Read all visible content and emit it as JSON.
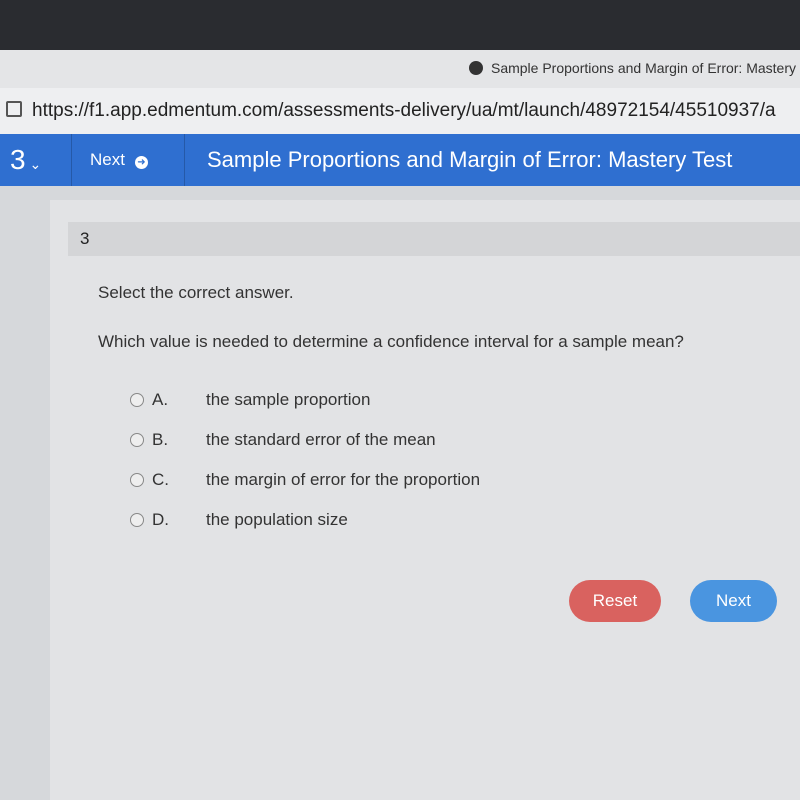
{
  "browser": {
    "tab_title": "Sample Proportions and Margin of Error: Mastery",
    "url": "https://f1.app.edmentum.com/assessments-delivery/ua/mt/launch/48972154/45510937/a"
  },
  "nav": {
    "question_number": "3",
    "next_label": "Next",
    "title": "Sample Proportions and Margin of Error: Mastery Test"
  },
  "question": {
    "number": "3",
    "instruction": "Select the correct answer.",
    "text": "Which value is needed to determine a confidence interval for a sample mean?",
    "options": [
      {
        "letter": "A.",
        "text": "the sample proportion"
      },
      {
        "letter": "B.",
        "text": "the standard error of the mean"
      },
      {
        "letter": "C.",
        "text": "the margin of error for the proportion"
      },
      {
        "letter": "D.",
        "text": "the population size"
      }
    ]
  },
  "buttons": {
    "reset": "Reset",
    "next": "Next"
  },
  "colors": {
    "nav": "#2f6fd0",
    "reset": "#d9625f",
    "next": "#4a95e0"
  }
}
